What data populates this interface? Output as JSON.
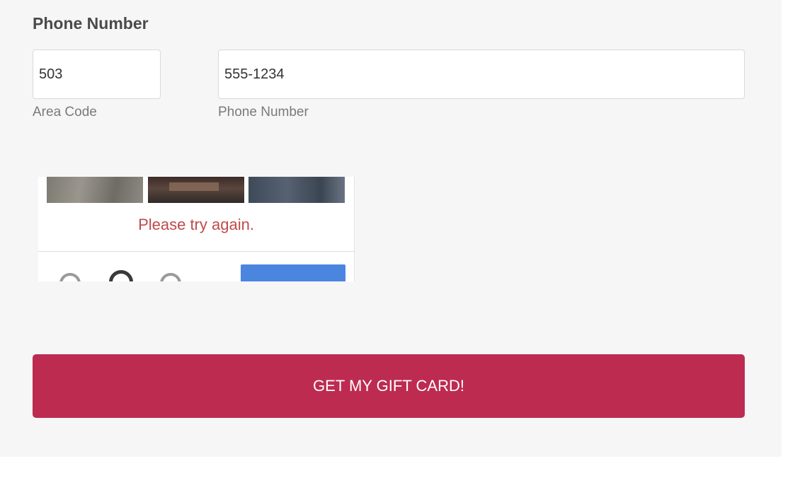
{
  "phone": {
    "label": "Phone Number",
    "area_code": {
      "value": "503",
      "caption": "Area Code"
    },
    "number": {
      "value": "555-1234",
      "caption": "Phone Number"
    }
  },
  "captcha": {
    "error_message": "Please try again.",
    "controls": [
      "reload-icon",
      "audio-icon",
      "info-icon"
    ],
    "verify_color": "#4a86e0"
  },
  "submit": {
    "label": "GET MY GIFT CARD!",
    "color": "#bd2b51"
  }
}
